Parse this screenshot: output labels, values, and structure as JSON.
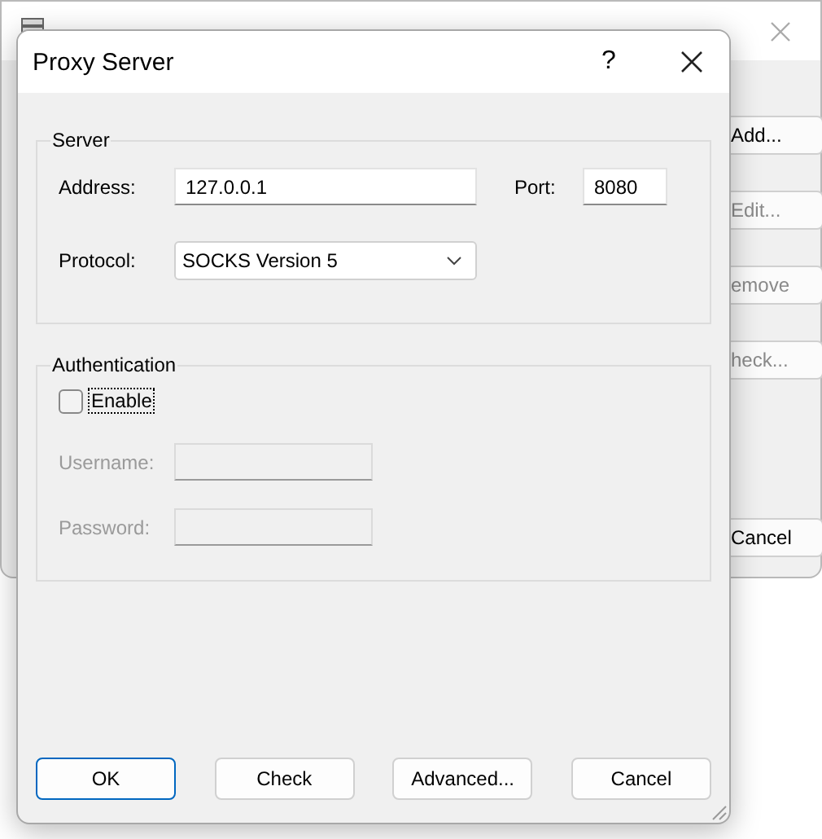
{
  "background_window": {
    "buttons": [
      {
        "label": "Add...",
        "disabled": false
      },
      {
        "label": "Edit...",
        "disabled": true
      },
      {
        "label": "emove",
        "disabled": true
      },
      {
        "label": "heck...",
        "disabled": true
      },
      {
        "label": "Cancel",
        "disabled": false
      }
    ]
  },
  "dialog": {
    "title": "Proxy Server",
    "help": "?",
    "server": {
      "legend": "Server",
      "address": {
        "label": "Address:",
        "value": "127.0.0.1"
      },
      "port": {
        "label": "Port:",
        "value": "8080"
      },
      "protocol": {
        "label": "Protocol:",
        "value": "SOCKS Version 5"
      }
    },
    "authentication": {
      "legend": "Authentication",
      "enable": {
        "label": "Enable",
        "checked": false
      },
      "username": {
        "label": "Username:",
        "disabled": true
      },
      "password": {
        "label": "Password:",
        "disabled": true
      }
    },
    "buttons": [
      {
        "label": "OK",
        "default": true
      },
      {
        "label": "Check",
        "default": false
      },
      {
        "label": "Advanced...",
        "default": false
      },
      {
        "label": "Cancel",
        "default": false
      }
    ]
  }
}
